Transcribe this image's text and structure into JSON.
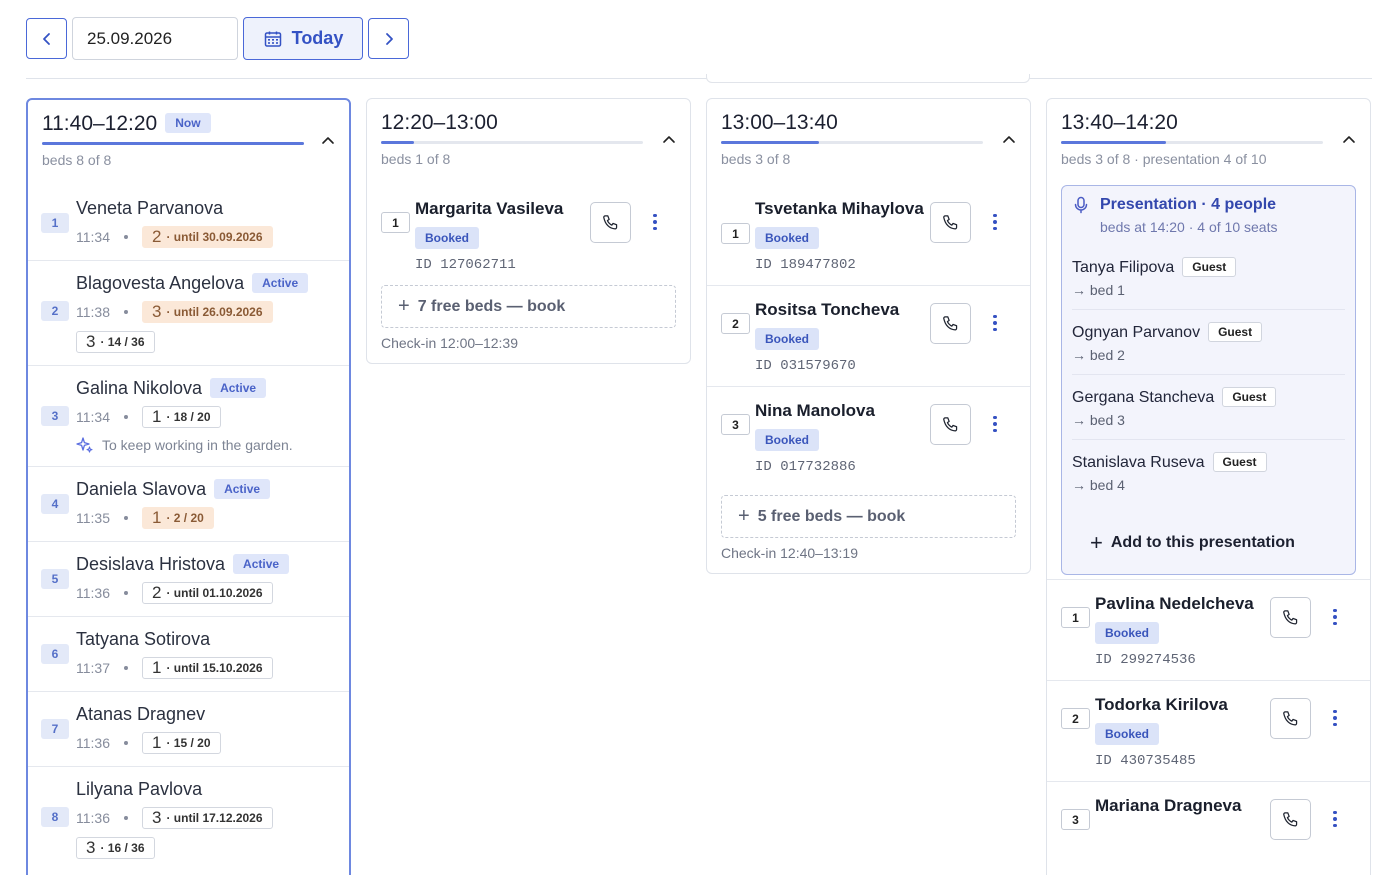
{
  "toolbar": {
    "date_value": "25.09.2026",
    "today_label": "Today"
  },
  "slots": [
    {
      "time": "11:40–12:20",
      "badge": "Now",
      "progress": 1.0,
      "beds_line": "beds 8 of 8",
      "waiting": [
        {
          "num": "1",
          "name": "Veneta Parvanova",
          "status": "",
          "time": "11:34",
          "pill_big": "2",
          "pill_text": "· until 30.09.2026",
          "pill_color": "orange"
        },
        {
          "num": "2",
          "name": "Blagovesta Angelova",
          "status": "Active",
          "time": "11:38",
          "pill_big": "3",
          "pill_text": "· until 26.09.2026",
          "pill_color": "orange",
          "pill2_big": "3",
          "pill2_text": "· 14 / 36"
        },
        {
          "num": "3",
          "name": "Galina Nikolova",
          "status": "Active",
          "time": "11:34",
          "pill_big": "1",
          "pill_text": "· 18 / 20",
          "pill_color": "plain",
          "note": "To keep working in the garden."
        },
        {
          "num": "4",
          "name": "Daniela Slavova",
          "status": "Active",
          "time": "11:35",
          "pill_big": "1",
          "pill_text": "· 2 / 20",
          "pill_color": "orange"
        },
        {
          "num": "5",
          "name": "Desislava Hristova",
          "status": "Active",
          "time": "11:36",
          "pill_big": "2",
          "pill_text": "· until 01.10.2026",
          "pill_color": "plain"
        },
        {
          "num": "6",
          "name": "Tatyana Sotirova",
          "status": "",
          "time": "11:37",
          "pill_big": "1",
          "pill_text": "· until 15.10.2026",
          "pill_color": "plain"
        },
        {
          "num": "7",
          "name": "Atanas Dragnev",
          "status": "",
          "time": "11:36",
          "pill_big": "1",
          "pill_text": "· 15 / 20",
          "pill_color": "plain"
        },
        {
          "num": "8",
          "name": "Lilyana Pavlova",
          "status": "",
          "time": "11:36",
          "pill_big": "3",
          "pill_text": "· until 17.12.2026",
          "pill_color": "plain",
          "pill2_big": "3",
          "pill2_text": "· 16 / 36"
        }
      ]
    },
    {
      "time": "12:20–13:00",
      "progress": 0.125,
      "beds_line": "beds 1 of 8",
      "bookings": [
        {
          "bed": "1",
          "name": "Margarita Vasileva",
          "status": "Booked",
          "id": "ID 127062711"
        }
      ],
      "free_label": "7 free beds — book",
      "checkin": "Check-in 12:00–12:39"
    },
    {
      "time": "13:00–13:40",
      "progress": 0.375,
      "beds_line": "beds 3 of 8",
      "bookings": [
        {
          "bed": "1",
          "name": "Tsvetanka Mihaylova",
          "status": "Booked",
          "id": "ID 189477802"
        },
        {
          "bed": "2",
          "name": "Rositsa Toncheva",
          "status": "Booked",
          "id": "ID 031579670"
        },
        {
          "bed": "3",
          "name": "Nina Manolova",
          "status": "Booked",
          "id": "ID 017732886"
        }
      ],
      "free_label": "5 free beds — book",
      "checkin": "Check-in 12:40–13:19"
    },
    {
      "time": "13:40–14:20",
      "progress": 0.4,
      "beds_line": "beds 3 of 8 · presentation 4 of 10",
      "presentation": {
        "title": "Presentation · 4 people",
        "subtitle": "beds at 14:20 · 4 of 10 seats",
        "guests": [
          {
            "name": "Tanya Filipova",
            "badge": "Guest",
            "bed": "→ bed 1"
          },
          {
            "name": "Ognyan Parvanov",
            "badge": "Guest",
            "bed": "→ bed 2"
          },
          {
            "name": "Gergana Stancheva",
            "badge": "Guest",
            "bed": "→ bed 3"
          },
          {
            "name": "Stanislava Ruseva",
            "badge": "Guest",
            "bed": "→ bed 4"
          }
        ],
        "add_label": "Add to this presentation"
      },
      "bookings": [
        {
          "bed": "1",
          "name": "Pavlina Nedelcheva",
          "status": "Booked",
          "id": "ID 299274536"
        },
        {
          "bed": "2",
          "name": "Todorka Kirilova",
          "status": "Booked",
          "id": "ID 430735485"
        },
        {
          "bed": "3",
          "name": "Mariana Dragneva",
          "status": "",
          "id": ""
        }
      ]
    }
  ],
  "colors": {
    "accent": "#4a68d8",
    "badge_bg": "#dfe6fa",
    "orange_pill": "#fbe8d8",
    "presentation_bg": "#f3f4fc"
  }
}
